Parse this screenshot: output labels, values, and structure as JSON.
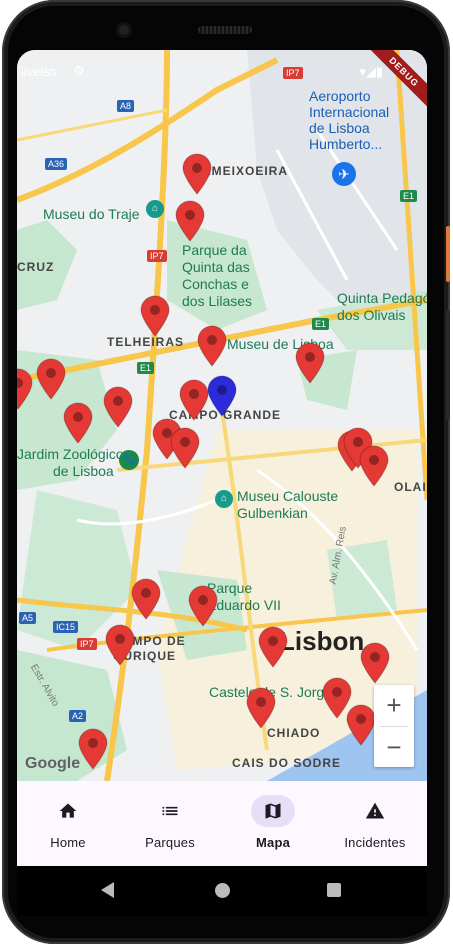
{
  "status_bar": {
    "carrier": "iivelss",
    "debug_banner": "DEBUG"
  },
  "map": {
    "labels": {
      "ameixoeira": "AMEIXOEIRA",
      "aeroporto": [
        "Aeroporto",
        "Internacional",
        "de Lisboa",
        "Humberto..."
      ],
      "museu_traje": "Museu do Traje",
      "parque_quinta": [
        "Parque da",
        "Quinta das",
        "Conchas e",
        "dos Lilases"
      ],
      "cruz": "CRUZ",
      "telheiras": "TELHEIRAS",
      "museu_lisboa": "Museu de Lisboa",
      "campo_grande": "CAMPO GRANDE",
      "quinta_pedago": [
        "Quinta Pedagó",
        "dos Olivais"
      ],
      "jardim": [
        "Jardim Zoológico",
        "de Lisboa"
      ],
      "museu_calouste": [
        "Museu Calouste",
        "Gulbenkian"
      ],
      "olaia": "OLAIA",
      "parque_eduardo": [
        "Parque",
        "Eduardo VII"
      ],
      "campo_ourique": [
        "CAMPO DE",
        "OURIQUE"
      ],
      "lisbon": "Lisbon",
      "castelo": "Castelo de S. Jorge",
      "chiado": "CHIADO",
      "cais": "CAIS DO SODRE",
      "estr_alvito": "Estr. Alvito",
      "av_alm_reis": "Av. Alm. Reis",
      "road_a8": "A8",
      "road_a36": "A36",
      "road_ip7a": "IP7",
      "road_ip7b": "IP7",
      "road_ip7c": "IP7",
      "road_e1a": "E1",
      "road_e1b": "E1",
      "road_e1c": "E1",
      "road_a5": "A5",
      "road_ic15": "IC15",
      "road_a2": "A2"
    },
    "attribution": "Google",
    "zoom_in": "+",
    "zoom_out": "−",
    "pin_color": "#e53935",
    "current_pin_color": "#2b2bd9"
  },
  "nav": {
    "items": [
      {
        "label": "Home",
        "icon": "home-icon"
      },
      {
        "label": "Parques",
        "icon": "list-icon"
      },
      {
        "label": "Mapa",
        "icon": "map-icon",
        "active": true
      },
      {
        "label": "Incidentes",
        "icon": "warning-icon"
      }
    ]
  }
}
